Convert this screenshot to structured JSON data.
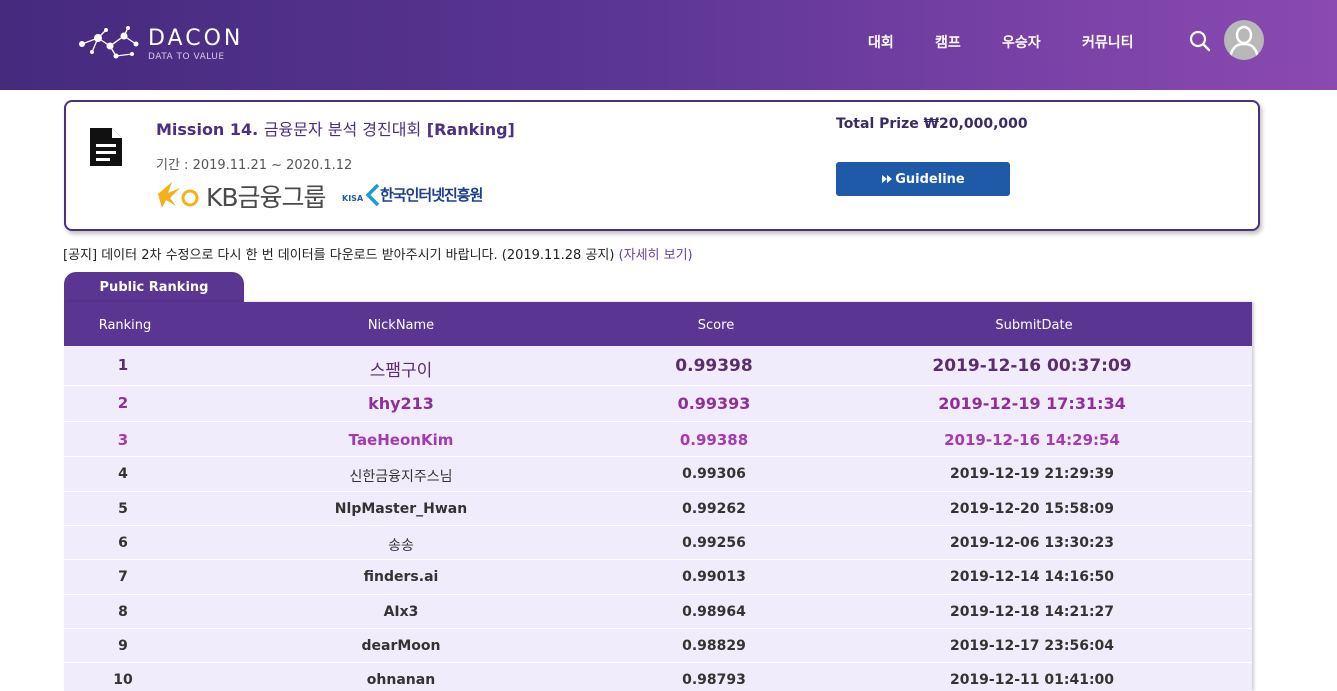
{
  "header": {
    "logo_text": "DACON",
    "logo_tagline": "DATA TO VALUE",
    "nav": [
      "대회",
      "캠프",
      "우승자",
      "커뮤니티"
    ]
  },
  "mission": {
    "title_prefix": "Mission 14.",
    "title_korean": "금융문자 분석 경진대회",
    "title_suffix": "[Ranking]",
    "period": "기간 : 2019.11.21 ~ 2020.1.12",
    "sponsor_kb": "KB금융그룹",
    "sponsor_kisa_small": "KISA",
    "sponsor_kisa": "한국인터넷진흥원",
    "prize": "Total Prize ₩20,000,000",
    "guideline_label": "Guideline"
  },
  "notice": {
    "text": "[공지] 데이터 2차 수정으로 다시 한 번 데이터를 다운로드 받아주시기 바랍니다. (2019.11.28 공지)",
    "more": "(자세히 보기)"
  },
  "tab": {
    "label": "Public Ranking"
  },
  "table": {
    "headers": [
      "Ranking",
      "NickName",
      "Score",
      "SubmitDate"
    ],
    "rows": [
      {
        "rank": "1",
        "nick": "스팸구이",
        "score": "0.99398",
        "date": "2019-12-16 00:37:09"
      },
      {
        "rank": "2",
        "nick": "khy213",
        "score": "0.99393",
        "date": "2019-12-19 17:31:34"
      },
      {
        "rank": "3",
        "nick": "TaeHeonKim",
        "score": "0.99388",
        "date": "2019-12-16 14:29:54"
      },
      {
        "rank": "4",
        "nick": "신한금융지주스님",
        "score": "0.99306",
        "date": "2019-12-19 21:29:39"
      },
      {
        "rank": "5",
        "nick": "NlpMaster_Hwan",
        "score": "0.99262",
        "date": "2019-12-20 15:58:09"
      },
      {
        "rank": "6",
        "nick": "송송",
        "score": "0.99256",
        "date": "2019-12-06 13:30:23"
      },
      {
        "rank": "7",
        "nick": "finders.ai",
        "score": "0.99013",
        "date": "2019-12-14 14:16:50"
      },
      {
        "rank": "8",
        "nick": "AIx3",
        "score": "0.98964",
        "date": "2019-12-18 14:21:27"
      },
      {
        "rank": "9",
        "nick": "dearMoon",
        "score": "0.98829",
        "date": "2019-12-17 23:56:04"
      },
      {
        "rank": "10",
        "nick": "ohnanan",
        "score": "0.98793",
        "date": "2019-12-11 01:41:00"
      }
    ]
  },
  "colors": {
    "header_start": "#452a7e",
    "header_end": "#8a4ab0",
    "rank1": "#5a2d6e",
    "rank2": "#8e2f9a",
    "rank3": "#a23bb0",
    "normal": "#333333",
    "guideline": "#1f5aa8"
  }
}
